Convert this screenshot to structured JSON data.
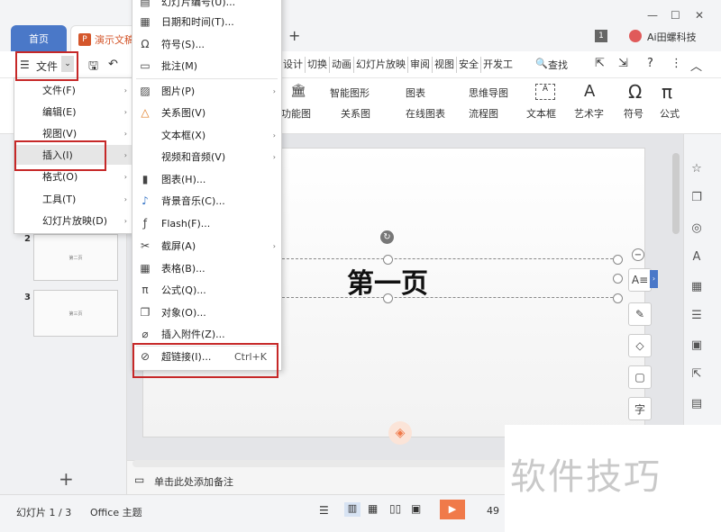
{
  "tabs": {
    "home": "首页",
    "document": "演示文稿"
  },
  "titlebar": {
    "page_num": "1",
    "user": "Ai田螺科技",
    "new_tab": "+"
  },
  "toolbar": {
    "file_label": "文件",
    "ribbon_tabs": [
      "设计",
      "切换",
      "动画",
      "幻灯片放映",
      "审阅",
      "视图",
      "安全",
      "开发工"
    ],
    "search_label": "查找"
  },
  "ribbon": {
    "row1": [
      "智能图形",
      "图表",
      "思维导图"
    ],
    "row2": [
      "功能图",
      "关系图",
      "在线图表",
      "流程图"
    ],
    "large": [
      "文本框",
      "艺术字",
      "符号",
      "公式"
    ]
  },
  "file_menu": {
    "items": [
      {
        "label": "文件(F)",
        "arrow": true
      },
      {
        "label": "编辑(E)",
        "arrow": true
      },
      {
        "label": "视图(V)",
        "arrow": true
      },
      {
        "label": "插入(I)",
        "arrow": true
      },
      {
        "label": "格式(O)",
        "arrow": true
      },
      {
        "label": "工具(T)",
        "arrow": true
      },
      {
        "label": "幻灯片放映(D)",
        "arrow": true
      }
    ]
  },
  "insert_menu": {
    "items": [
      {
        "label": "幻灯片编号(U)...",
        "icon": "slide-number-icon"
      },
      {
        "label": "日期和时间(T)...",
        "icon": "calendar-icon"
      },
      {
        "label": "符号(S)...",
        "icon": "omega-icon"
      },
      {
        "label": "批注(M)",
        "icon": "comment-icon"
      },
      {
        "label": "图片(P)",
        "icon": "image-icon",
        "arrow": true
      },
      {
        "label": "关系图(V)",
        "icon": "relation-icon"
      },
      {
        "label": "文本框(X)",
        "icon": "",
        "arrow": true
      },
      {
        "label": "视频和音频(V)",
        "icon": "",
        "arrow": true
      },
      {
        "label": "图表(H)...",
        "icon": "chart-icon"
      },
      {
        "label": "背景音乐(C)...",
        "icon": "music-icon"
      },
      {
        "label": "Flash(F)...",
        "icon": "flash-icon"
      },
      {
        "label": "截屏(A)",
        "icon": "screenshot-icon",
        "arrow": true
      },
      {
        "label": "表格(B)...",
        "icon": "table-icon"
      },
      {
        "label": "公式(Q)...",
        "icon": "pi-icon"
      },
      {
        "label": "对象(O)...",
        "icon": "object-icon"
      },
      {
        "label": "插入附件(Z)...",
        "icon": "attachment-icon"
      },
      {
        "label": "超链接(I)...",
        "icon": "link-icon",
        "shortcut": "Ctrl+K"
      }
    ]
  },
  "slides": [
    {
      "num": "2",
      "thumb_text": "第二页"
    },
    {
      "num": "3",
      "thumb_text": "第三页"
    }
  ],
  "slide": {
    "title": "第一页"
  },
  "notes": {
    "placeholder": "单击此处添加备注",
    "add_slide": "+"
  },
  "status": {
    "slide_info": "幻灯片 1 / 3",
    "theme": "Office 主题",
    "zoom": "49"
  },
  "watermark": {
    "text": "软件技巧"
  },
  "colors": {
    "accent_blue": "#4a78c8",
    "doc_orange": "#d4562b",
    "highlight_red": "#c62828",
    "play_orange": "#f07a4a"
  }
}
